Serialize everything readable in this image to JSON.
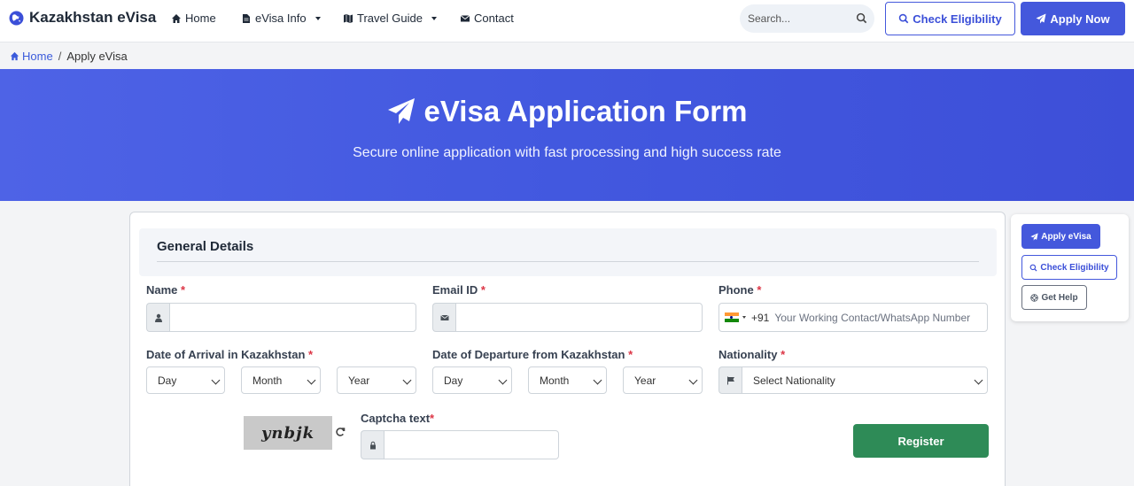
{
  "navbar": {
    "brand": "Kazakhstan eVisa",
    "items": [
      {
        "label": "Home",
        "icon": "home-icon"
      },
      {
        "label": "eVisa Info",
        "icon": "file-icon",
        "dropdown": true
      },
      {
        "label": "Travel Guide",
        "icon": "map-icon",
        "dropdown": true
      },
      {
        "label": "Contact",
        "icon": "envelope-icon"
      }
    ],
    "search_placeholder": "Search...",
    "check_eligibility": "Check Eligibility",
    "apply_now": "Apply Now",
    "accent_color": "#4458dc"
  },
  "breadcrumb": {
    "home": "Home",
    "separator": "/",
    "current": "Apply eVisa"
  },
  "hero": {
    "title": "eVisa Application Form",
    "subtitle": "Secure online application with fast processing and high success rate"
  },
  "form": {
    "section_title": "General Details",
    "required_mark": "*",
    "name_label": "Name",
    "email_label": "Email ID",
    "phone_label": "Phone",
    "phone_code": "+91",
    "phone_placeholder": "Your Working Contact/WhatsApp Number",
    "arrival_label": "Date of Arrival in Kazakhstan",
    "departure_label": "Date of Departure from Kazakhstan",
    "nationality_label": "Nationality",
    "nationality_selected": "Select Nationality",
    "arrival_day": "Day",
    "arrival_month": "Month",
    "arrival_year": "Year",
    "departure_day": "Day",
    "departure_month": "Month",
    "departure_year": "Year",
    "captcha_image_text": "ynbjk",
    "captcha_label": "Captcha text",
    "register_button": "Register",
    "register_color": "#2e8b57"
  },
  "side_panel": {
    "apply": "Apply eVisa",
    "check": "Check Eligibility",
    "help": "Get Help"
  }
}
